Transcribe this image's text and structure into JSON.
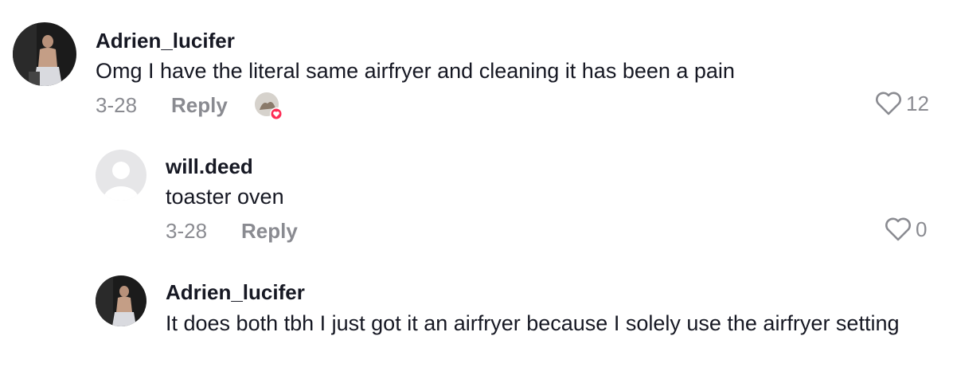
{
  "comments": [
    {
      "username": "Adrien_lucifer",
      "text": "Omg I have the literal same airfryer and cleaning it has been a pain",
      "date": "3-28",
      "reply_label": "Reply",
      "likes": "12",
      "liked_by_creator": true
    },
    {
      "username": "will.deed",
      "text": "toaster oven",
      "date": "3-28",
      "reply_label": "Reply",
      "likes": "0"
    },
    {
      "username": "Adrien_lucifer",
      "text": "It does both tbh I just got it an airfryer because I solely use the airfryer setting"
    }
  ],
  "colors": {
    "text_primary": "#161823",
    "text_secondary": "#8a8b91",
    "heart_badge": "#fe2c55"
  }
}
